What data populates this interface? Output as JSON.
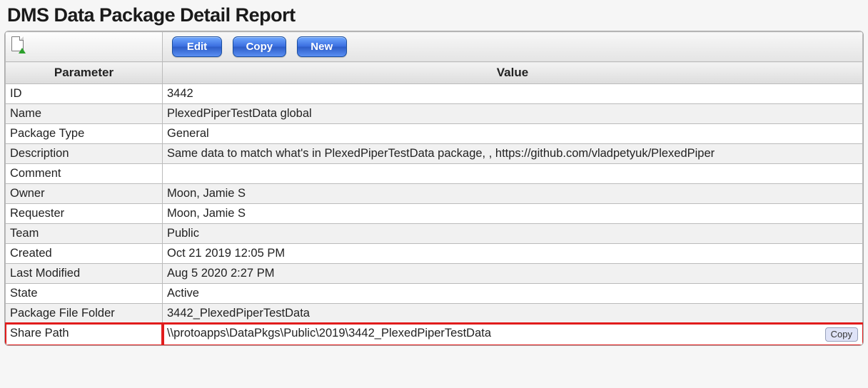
{
  "title": "DMS Data Package Detail Report",
  "toolbar": {
    "edit_label": "Edit",
    "copy_label": "Copy",
    "new_label": "New"
  },
  "headers": {
    "parameter": "Parameter",
    "value": "Value"
  },
  "rows": [
    {
      "param": "ID",
      "value": "3442"
    },
    {
      "param": "Name",
      "value": "PlexedPiperTestData global"
    },
    {
      "param": "Package Type",
      "value": "General"
    },
    {
      "param": "Description",
      "value": "Same data to match what's in PlexedPiperTestData package, , https://github.com/vladpetyuk/PlexedPiper"
    },
    {
      "param": "Comment",
      "value": ""
    },
    {
      "param": "Owner",
      "value": "Moon, Jamie S"
    },
    {
      "param": "Requester",
      "value": "Moon, Jamie S"
    },
    {
      "param": "Team",
      "value": "Public"
    },
    {
      "param": "Created",
      "value": "Oct 21 2019 12:05 PM"
    },
    {
      "param": "Last Modified",
      "value": "Aug 5 2020 2:27 PM"
    },
    {
      "param": "State",
      "value": "Active"
    },
    {
      "param": "Package File Folder",
      "value": "3442_PlexedPiperTestData"
    },
    {
      "param": "Share Path",
      "value": "\\\\protoapps\\DataPkgs\\Public\\2019\\3442_PlexedPiperTestData"
    }
  ],
  "share_path": {
    "copy_chip_label": "Copy"
  },
  "highlight_row_index": 12
}
